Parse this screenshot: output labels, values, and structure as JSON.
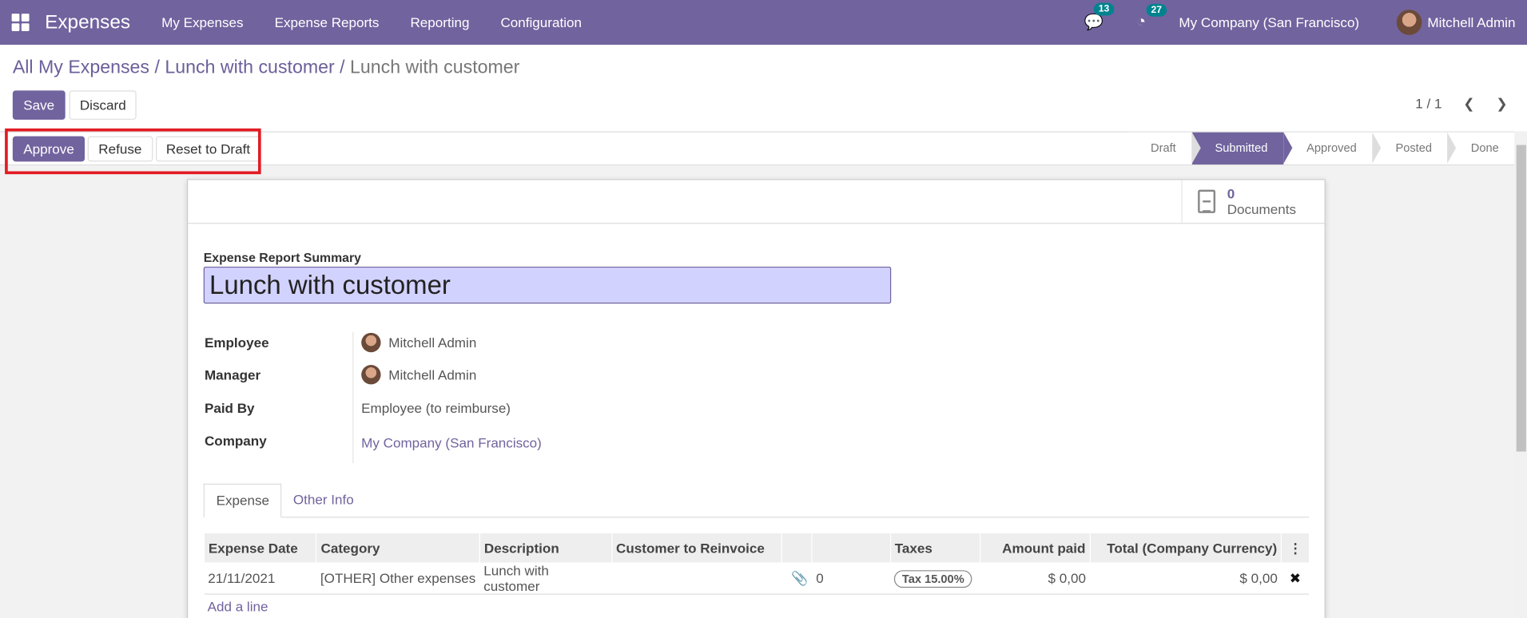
{
  "navbar": {
    "app": "Expenses",
    "menus": [
      "My Expenses",
      "Expense Reports",
      "Reporting",
      "Configuration"
    ],
    "messages_count": "13",
    "activities_count": "27",
    "company": "My Company (San Francisco)",
    "user": "Mitchell Admin"
  },
  "breadcrumb": {
    "items": [
      "All My Expenses",
      "Lunch with customer"
    ],
    "current": "Lunch with customer",
    "sep": "/"
  },
  "control": {
    "save": "Save",
    "discard": "Discard",
    "pager": "1 / 1"
  },
  "statusbar": {
    "actions": [
      "Approve",
      "Refuse",
      "Reset to Draft"
    ],
    "stages": [
      "Draft",
      "Submitted",
      "Approved",
      "Posted",
      "Done"
    ],
    "active_stage": "Submitted",
    "highlight_color": "#e21c24"
  },
  "sheet": {
    "documents": {
      "count": "0",
      "label": "Documents"
    },
    "summary_label": "Expense Report Summary",
    "summary_value": "Lunch with customer",
    "fields": [
      {
        "label": "Employee",
        "value": "Mitchell Admin"
      },
      {
        "label": "Manager",
        "value": "Mitchell Admin"
      },
      {
        "label": "Paid By",
        "value": "Employee (to reimburse)"
      },
      {
        "label": "Company",
        "value": "My Company (San Francisco)"
      }
    ],
    "tabs": [
      "Expense",
      "Other Info"
    ],
    "table": {
      "headers": [
        "Expense Date",
        "Category",
        "Description",
        "Customer to Reinvoice",
        "",
        "",
        "Taxes",
        "Amount paid",
        "Total (Company Currency)"
      ],
      "rows": [
        {
          "date": "21/11/2021",
          "category": "[OTHER] Other expenses",
          "description": "Lunch with customer",
          "customer": "",
          "attachments": "0",
          "tax": "Tax 15.00%",
          "amount": "$ 0,00",
          "total": "$ 0,00"
        }
      ],
      "add_line": "Add a line"
    }
  },
  "colors": {
    "brand": "#71639e",
    "badge": "#00838f"
  }
}
